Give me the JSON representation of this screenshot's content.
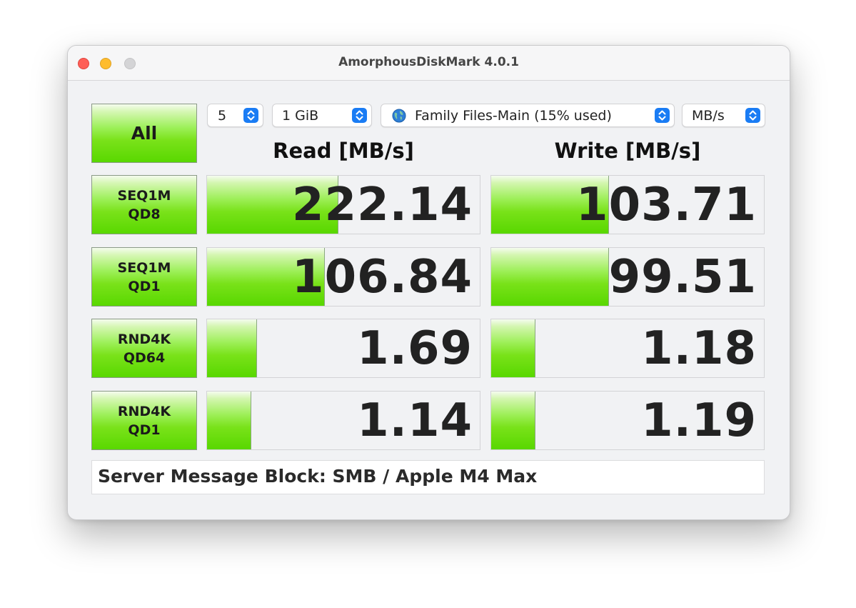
{
  "window": {
    "title": "AmorphousDiskMark 4.0.1"
  },
  "controls": {
    "all_button": "All",
    "count": "5",
    "size": "1 GiB",
    "target": "Family Files-Main (15% used)",
    "unit": "MB/s",
    "target_icon": "globe-icon",
    "stepper_icon": "up-down-chevron-icon",
    "accent_color": "#1a7cf4"
  },
  "headers": {
    "read": "Read [MB/s]",
    "write": "Write [MB/s]"
  },
  "tests": [
    {
      "line1": "SEQ1M",
      "line2": "QD8",
      "read": "222.14",
      "write": "103.71",
      "read_fill_pct": 48,
      "write_fill_pct": 43
    },
    {
      "line1": "SEQ1M",
      "line2": "QD1",
      "read": "106.84",
      "write": "99.51",
      "read_fill_pct": 43,
      "write_fill_pct": 43
    },
    {
      "line1": "RND4K",
      "line2": "QD64",
      "read": "1.69",
      "write": "1.18",
      "read_fill_pct": 18,
      "write_fill_pct": 16
    },
    {
      "line1": "RND4K",
      "line2": "QD1",
      "read": "1.14",
      "write": "1.19",
      "read_fill_pct": 16,
      "write_fill_pct": 16
    }
  ],
  "status": {
    "message": "Server Message Block: SMB / Apple M4 Max"
  },
  "colors": {
    "bar_green": "#59d800",
    "close": "#fe5f57",
    "minimize": "#febc2e",
    "zoom_inactive": "#d4d4d6"
  }
}
